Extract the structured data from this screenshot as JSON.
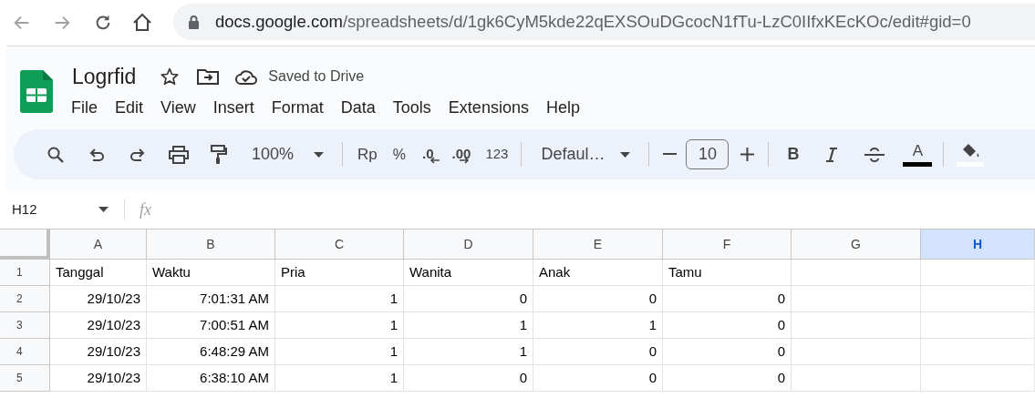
{
  "browser": {
    "url_host": "docs.google.com",
    "url_path": "/spreadsheets/d/1gk6CyM5kde22qEXSOuDGcocN1fTu-LzC0IIfxKEcKOc/edit#gid=0"
  },
  "document": {
    "title": "Logrfid",
    "save_status": "Saved to Drive"
  },
  "menu": [
    "File",
    "Edit",
    "View",
    "Insert",
    "Format",
    "Data",
    "Tools",
    "Extensions",
    "Help"
  ],
  "toolbar": {
    "zoom": "100%",
    "currency": "Rp",
    "percent": "%",
    "decrease_decimals": ".0",
    "increase_decimals": ".00",
    "number_format": "123",
    "font": "Defaul…",
    "font_size": "10",
    "bold": "B",
    "text_color": "A"
  },
  "formula_bar": {
    "name_box": "H12",
    "function_label": "fx"
  },
  "sheet": {
    "columns": [
      {
        "label": "A",
        "selected": false
      },
      {
        "label": "B",
        "selected": false
      },
      {
        "label": "C",
        "selected": false
      },
      {
        "label": "D",
        "selected": false
      },
      {
        "label": "E",
        "selected": false
      },
      {
        "label": "F",
        "selected": false
      },
      {
        "label": "G",
        "selected": false
      },
      {
        "label": "H",
        "selected": true
      }
    ],
    "rows": [
      {
        "number": "1",
        "kind": "text",
        "cells": [
          "Tanggal",
          "Waktu",
          "Pria",
          "Wanita",
          "Anak",
          "Tamu"
        ]
      },
      {
        "number": "2",
        "kind": "number",
        "cells": [
          "29/10/23",
          "7:01:31 AM",
          "1",
          "0",
          "0",
          "0"
        ]
      },
      {
        "number": "3",
        "kind": "number",
        "cells": [
          "29/10/23",
          "7:00:51 AM",
          "1",
          "1",
          "1",
          "0"
        ]
      },
      {
        "number": "4",
        "kind": "number",
        "cells": [
          "29/10/23",
          "6:48:29 AM",
          "1",
          "1",
          "0",
          "0"
        ]
      },
      {
        "number": "5",
        "kind": "number",
        "cells": [
          "29/10/23",
          "6:38:10 AM",
          "1",
          "0",
          "0",
          "0"
        ]
      }
    ]
  }
}
